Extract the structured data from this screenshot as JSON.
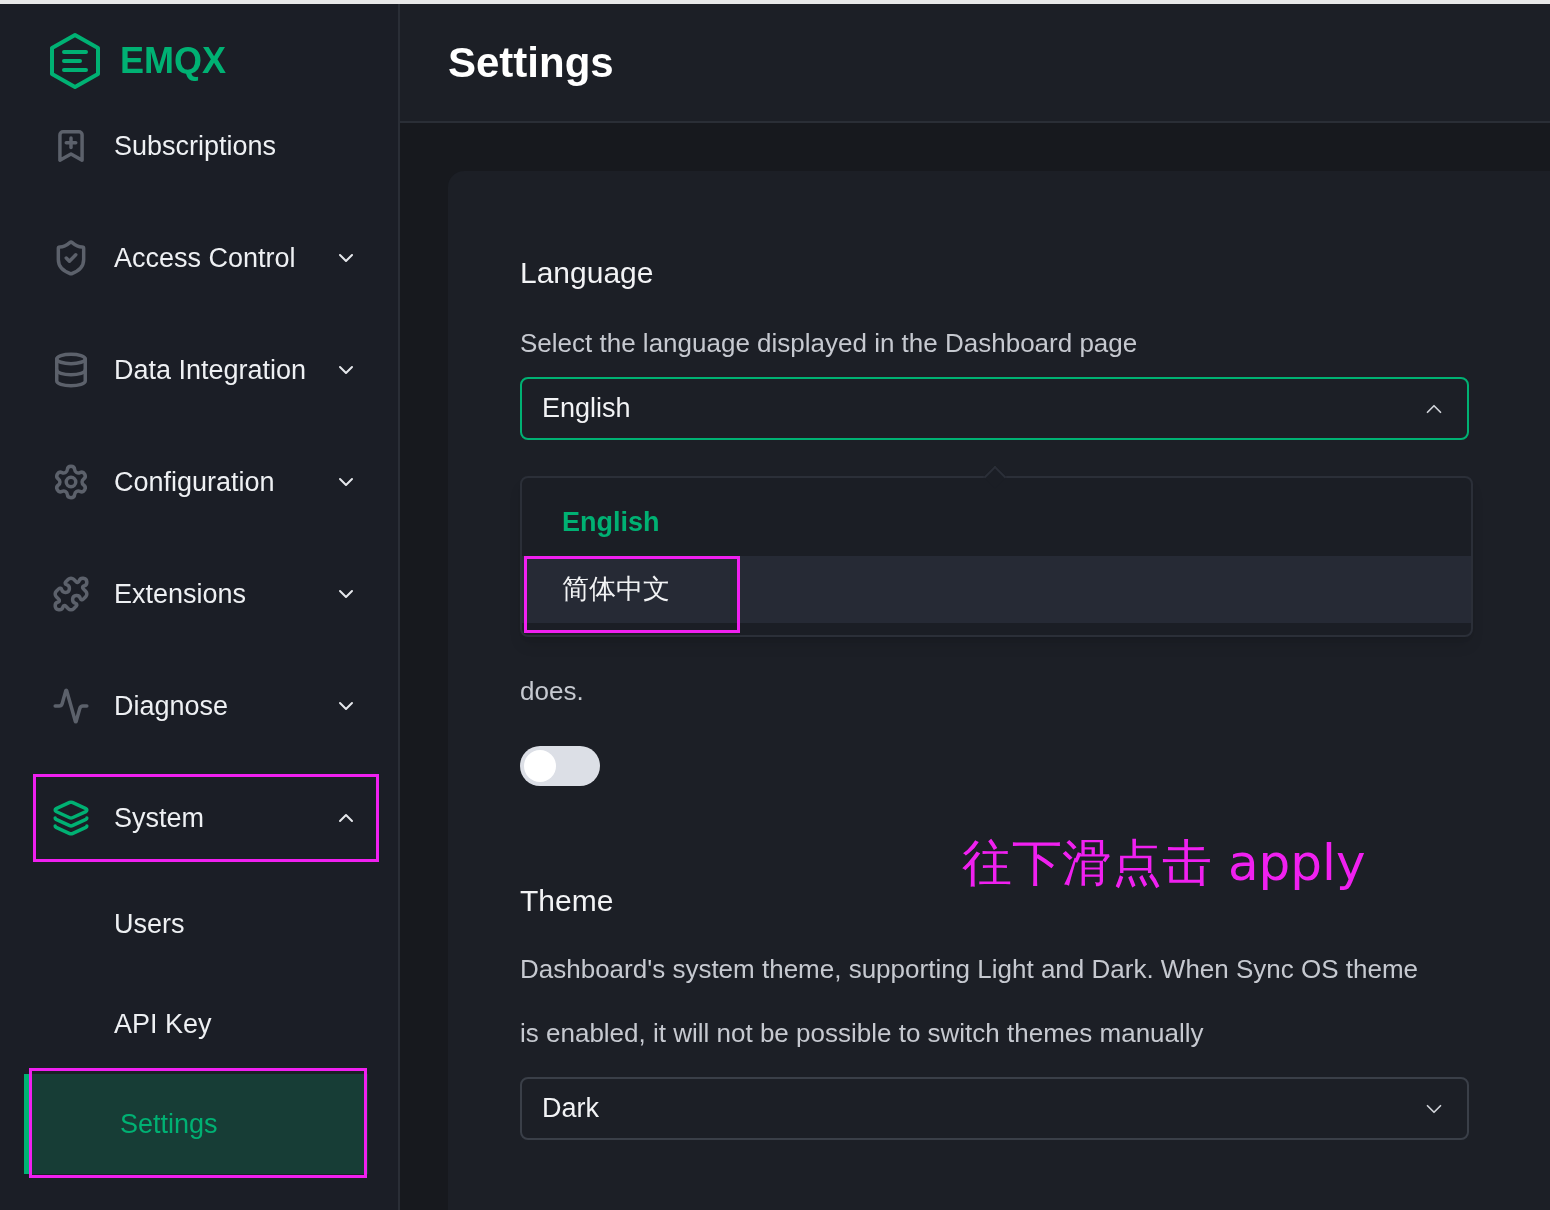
{
  "brand": "EMQX",
  "sidebar": {
    "items": [
      {
        "label": "Subscriptions",
        "kind": "link",
        "annotated": false
      },
      {
        "label": "Access Control",
        "kind": "group",
        "expanded": false,
        "annotated": false
      },
      {
        "label": "Data Integration",
        "kind": "group",
        "expanded": false,
        "annotated": false
      },
      {
        "label": "Configuration",
        "kind": "group",
        "expanded": false,
        "annotated": false
      },
      {
        "label": "Extensions",
        "kind": "group",
        "expanded": false,
        "annotated": false
      },
      {
        "label": "Diagnose",
        "kind": "group",
        "expanded": false,
        "annotated": false
      },
      {
        "label": "System",
        "kind": "group",
        "expanded": true,
        "annotated": true,
        "children": [
          {
            "label": "Users",
            "selected": false,
            "annotated": false
          },
          {
            "label": "API Key",
            "selected": false,
            "annotated": false
          },
          {
            "label": "Settings",
            "selected": true,
            "annotated": true
          }
        ]
      }
    ]
  },
  "page": {
    "title": "Settings"
  },
  "language": {
    "title": "Language",
    "description": "Select the language displayed in the Dashboard page",
    "select": {
      "value": "English",
      "open": true,
      "options": [
        {
          "label": "English",
          "selected": true,
          "hovered": false,
          "annotated": false
        },
        {
          "label": "简体中文",
          "selected": false,
          "hovered": true,
          "annotated": true
        }
      ]
    }
  },
  "sync_os": {
    "description": "does.",
    "toggle": {
      "on": false
    }
  },
  "annotation": "往下滑点击 apply",
  "theme": {
    "title": "Theme",
    "description": "Dashboard's system theme, supporting Light and Dark. When Sync OS theme is enabled, it will not be possible to switch themes manually",
    "select": {
      "value": "Dark",
      "open": false
    }
  }
}
